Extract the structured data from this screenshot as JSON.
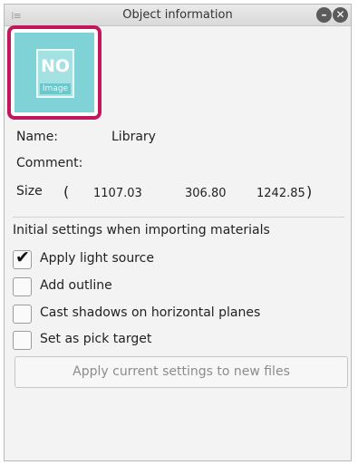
{
  "panel": {
    "title": "Object information",
    "grip_icon": "⁞≡",
    "minimize_glyph": "–",
    "close_glyph": "✕"
  },
  "thumbnail": {
    "no_text": "NO",
    "image_text": "Image",
    "selection_color": "#c2185b",
    "fill_color": "#7fd3d6"
  },
  "info": {
    "name_label": "Name:",
    "name_value": "Library",
    "comment_label": "Comment:",
    "comment_value": "",
    "size_label": "Size",
    "size_open": "(",
    "size_x": "1107.03",
    "size_y": "306.80",
    "size_z": "1242.85",
    "size_close": ")"
  },
  "settings": {
    "heading": "Initial settings when importing materials",
    "options": [
      {
        "label": "Apply light source",
        "checked": true
      },
      {
        "label": "Add outline",
        "checked": false
      },
      {
        "label": "Cast shadows on horizontal planes",
        "checked": false
      },
      {
        "label": "Set as pick target",
        "checked": false
      }
    ],
    "apply_button": "Apply current settings to new files"
  }
}
